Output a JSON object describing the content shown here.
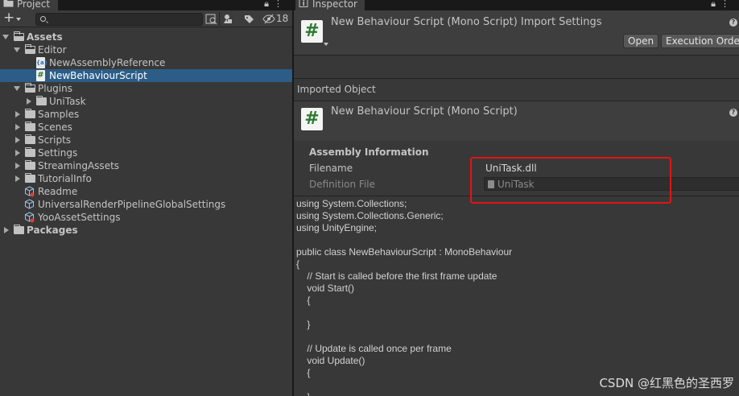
{
  "project": {
    "tab_label": "Project",
    "tab_icon": "folder-icon",
    "toolbar": {
      "add_label": "+",
      "search_placeholder": "",
      "hidden_count": "18"
    },
    "tree": [
      {
        "label": "Assets",
        "type": "folder-open",
        "bold": true,
        "expanded": true
      },
      {
        "label": "Editor",
        "type": "folder-open",
        "expanded": true
      },
      {
        "label": "NewAssemblyReference",
        "type": "asmref"
      },
      {
        "label": "NewBehaviourScript",
        "type": "script",
        "selected": true
      },
      {
        "label": "Plugins",
        "type": "folder-open",
        "expanded": true
      },
      {
        "label": "UniTask",
        "type": "folder"
      },
      {
        "label": "Samples",
        "type": "folder"
      },
      {
        "label": "Scenes",
        "type": "folder"
      },
      {
        "label": "Scripts",
        "type": "folder"
      },
      {
        "label": "Settings",
        "type": "folder"
      },
      {
        "label": "StreamingAssets",
        "type": "folder"
      },
      {
        "label": "TutorialInfo",
        "type": "folder"
      },
      {
        "label": "Readme",
        "type": "asset"
      },
      {
        "label": "UniversalRenderPipelineGlobalSettings",
        "type": "asset"
      },
      {
        "label": "YooAssetSettings",
        "type": "asset"
      },
      {
        "label": "Packages",
        "type": "folder",
        "bold": true
      }
    ]
  },
  "inspector": {
    "tab_label": "Inspector",
    "title": "New Behaviour Script (Mono Script) Import Settings",
    "open_button": "Open",
    "execution_order_button": "Execution Order...",
    "imported_object_label": "Imported Object",
    "imported_title": "New Behaviour Script (Mono Script)",
    "assembly": {
      "heading": "Assembly Information",
      "filename_label": "Filename",
      "filename_value": "UniTask.dll",
      "definition_label": "Definition File",
      "definition_value": "UniTask"
    },
    "code_lines": [
      "using System.Collections;",
      "using System.Collections.Generic;",
      "using UnityEngine;",
      "",
      "public class NewBehaviourScript : MonoBehaviour",
      "{",
      "    // Start is called before the first frame update",
      "    void Start()",
      "    {",
      "",
      "    }",
      "",
      "    // Update is called once per frame",
      "    void Update()",
      "    {",
      "",
      "    }"
    ]
  },
  "watermark": "CSDN @红黑色的圣西罗",
  "colors": {
    "selection": "#2c5d87",
    "highlight_box": "#e01515",
    "script_icon_green": "#2f7a32"
  }
}
